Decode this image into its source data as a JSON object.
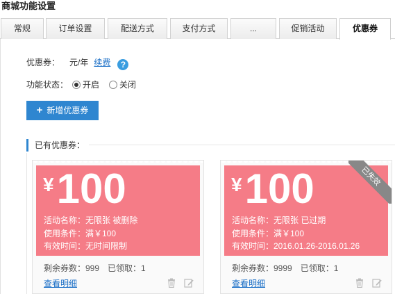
{
  "page": {
    "title": "商城功能设置"
  },
  "tabs": [
    {
      "label": "常规",
      "active": false
    },
    {
      "label": "订单设置",
      "active": false
    },
    {
      "label": "配送方式",
      "active": false
    },
    {
      "label": "支付方式",
      "active": false
    },
    {
      "label": "...",
      "active": false
    },
    {
      "label": "促销活动",
      "active": false
    },
    {
      "label": "优惠券",
      "active": true
    }
  ],
  "fee": {
    "label": "优惠券：",
    "value": "元/年",
    "renew_link": "续费",
    "help_icon": "question-icon"
  },
  "status": {
    "label": "功能状态：",
    "options": [
      "开启",
      "关闭"
    ],
    "selected": "开启"
  },
  "add_button": {
    "label": "新增优惠券",
    "icon": "plus-icon"
  },
  "section": {
    "title": "已有优惠券："
  },
  "coupons": [
    {
      "currency": "¥",
      "amount": "100",
      "name_line": "活动名称：无限张 被删除",
      "condition_line": "使用条件：满￥100",
      "validity_line": "有效时间：无时间限制",
      "remaining": "剩余券数：999",
      "claimed": "已领取：1",
      "detail_link": "查看明细",
      "ribbon": ""
    },
    {
      "currency": "¥",
      "amount": "100",
      "name_line": "活动名称：无限张 已过期",
      "condition_line": "使用条件：满￥100",
      "validity_line": "有效时间：2016.01.26-2016.01.26",
      "remaining": "剩余券数：9999",
      "claimed": "已领取：1",
      "detail_link": "查看明细",
      "ribbon": "已失效"
    }
  ],
  "colors": {
    "accent": "#2f86d0",
    "coupon": "#f57c87",
    "link": "#1b6fc7",
    "ribbon": "#888888"
  }
}
